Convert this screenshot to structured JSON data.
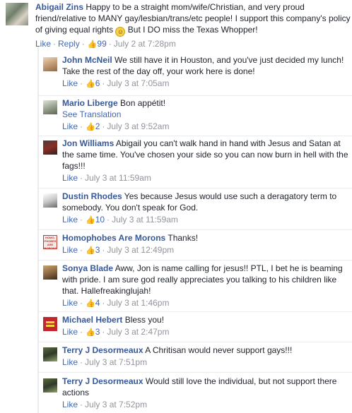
{
  "parent": {
    "author": "Abigail Zins",
    "text_before_emoji": "Happy to be a straight mom/wife/Christian, and very proud friend/relative to MANY gay/lesbian/trans/etc people! I support this company's policy of giving equal rights",
    "text_after_emoji": "But I DO miss the Texas Whopper!",
    "like_label": "Like",
    "reply_label": "Reply",
    "like_count": "99",
    "timestamp": "July 2 at 7:28pm"
  },
  "replies": [
    {
      "author": "John McNeil",
      "text": "We still have it in Houston, and you've just decided my lunch! Take the rest of the day off, your work here is done!",
      "like_label": "Like",
      "like_count": "6",
      "timestamp": "July 3 at 7:05am"
    },
    {
      "author": "Mario Liberge",
      "text": "Bon appétit!",
      "see_translation": "See Translation",
      "like_label": "Like",
      "like_count": "2",
      "timestamp": "July 3 at 9:52am"
    },
    {
      "author": "Jon Williams",
      "text": "Abigail you can't walk hand in hand with Jesus and Satan at the same time. You've chosen your side so you can now burn in hell with the fags!!!",
      "like_label": "Like",
      "timestamp": "July 3 at 11:59am"
    },
    {
      "author": "Dustin Rhodes",
      "text": "Yes because Jesus would use such a deragatory term to somebody. You don't speak for God.",
      "like_label": "Like",
      "like_count": "10",
      "timestamp": "July 3 at 11:59am"
    },
    {
      "author": "Homophobes Are Morons",
      "text": "Thanks!",
      "like_label": "Like",
      "like_count": "3",
      "timestamp": "July 3 at 12:49pm",
      "avatar_text": "HOMO-PHOBES ARE MORONS"
    },
    {
      "author": "Sonya Blade",
      "text": "Aww, Jon is name calling for jesus!! PTL, I bet he is beaming with pride. I am sure god really appreciates you talking to his children like that. Hallefreakinglujah!",
      "like_label": "Like",
      "like_count": "4",
      "timestamp": "July 3 at 1:46pm"
    },
    {
      "author": "Michael Hebert",
      "text": "Bless you!",
      "like_label": "Like",
      "like_count": "3",
      "timestamp": "July 3 at 2:47pm"
    },
    {
      "author": "Terry J Desormeaux",
      "text": "A Chritisan would never support gays!!!",
      "like_label": "Like",
      "timestamp": "July 3 at 7:51pm"
    },
    {
      "author": "Terry J Desormeaux",
      "text": "Would still love the individual, but not support there actions",
      "like_label": "Like",
      "timestamp": "July 3 at 7:52pm"
    }
  ],
  "icons": {
    "like_thumb": "thumbs-up-icon",
    "emoji": "smiley-emoji-icon"
  },
  "colors": {
    "author": "#365899",
    "link": "#4267b2",
    "meta": "#90949c",
    "text": "#1d2129",
    "divider": "#e9ebee"
  }
}
